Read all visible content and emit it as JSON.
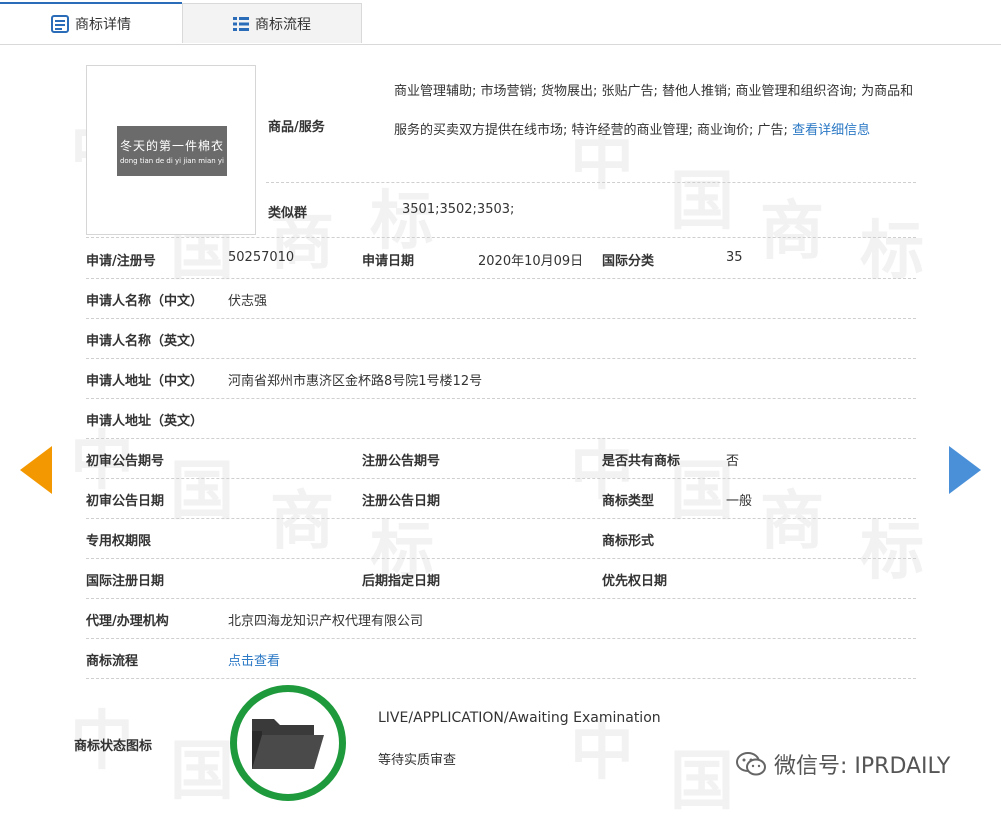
{
  "tabs": [
    {
      "label": "商标详情",
      "active": true
    },
    {
      "label": "商标流程",
      "active": false
    }
  ],
  "watermark_chars": [
    "中",
    "国",
    "商",
    "标"
  ],
  "logo": {
    "text_cn": "冬天的第一件棉衣",
    "text_pinyin": "dong tian de di yi jian mian yi"
  },
  "goods": {
    "label": "商品/服务",
    "text": "商业管理辅助; 市场营销; 货物展出; 张贴广告; 替他人推销; 商业管理和组织咨询; 为商品和服务的买卖双方提供在线市场; 特许经营的商业管理; 商业询价; 广告; ",
    "link": "查看详细信息"
  },
  "similar_group": {
    "label": "类似群",
    "value": "3501;3502;3503;"
  },
  "fields": {
    "app_no_label": "申请/注册号",
    "app_no": "50257010",
    "app_date_label": "申请日期",
    "app_date": "2020年10月09日",
    "intl_class_label": "国际分类",
    "intl_class": "35",
    "applicant_cn_label": "申请人名称（中文）",
    "applicant_cn": "伏志强",
    "applicant_en_label": "申请人名称（英文）",
    "address_cn_label": "申请人地址（中文）",
    "address_cn": "河南省郑州市惠济区金杯路8号院1号楼12号",
    "address_en_label": "申请人地址（英文）",
    "prelim_no_label": "初审公告期号",
    "reg_no_label": "注册公告期号",
    "shared_label": "是否共有商标",
    "shared": "否",
    "prelim_date_label": "初审公告日期",
    "reg_date_label": "注册公告日期",
    "type_label": "商标类型",
    "type": "一般",
    "term_label": "专用权期限",
    "form_label": "商标形式",
    "intl_reg_date_label": "国际注册日期",
    "later_date_label": "后期指定日期",
    "priority_date_label": "优先权日期",
    "agent_label": "代理/办理机构",
    "agent": "北京四海龙知识产权代理有限公司",
    "flow_label": "商标流程",
    "flow_link": "点击查看",
    "status_label": "商标状态图标",
    "status_en": "LIVE/APPLICATION/Awaiting Examination",
    "status_cn": "等待实质审查"
  },
  "wechat": {
    "text": "微信号: IPRDAILY"
  },
  "colors": {
    "accent": "#2b78c5",
    "arrow_left": "#f39800",
    "arrow_right": "#4a90d9",
    "status_ring": "#1e9a3c"
  }
}
